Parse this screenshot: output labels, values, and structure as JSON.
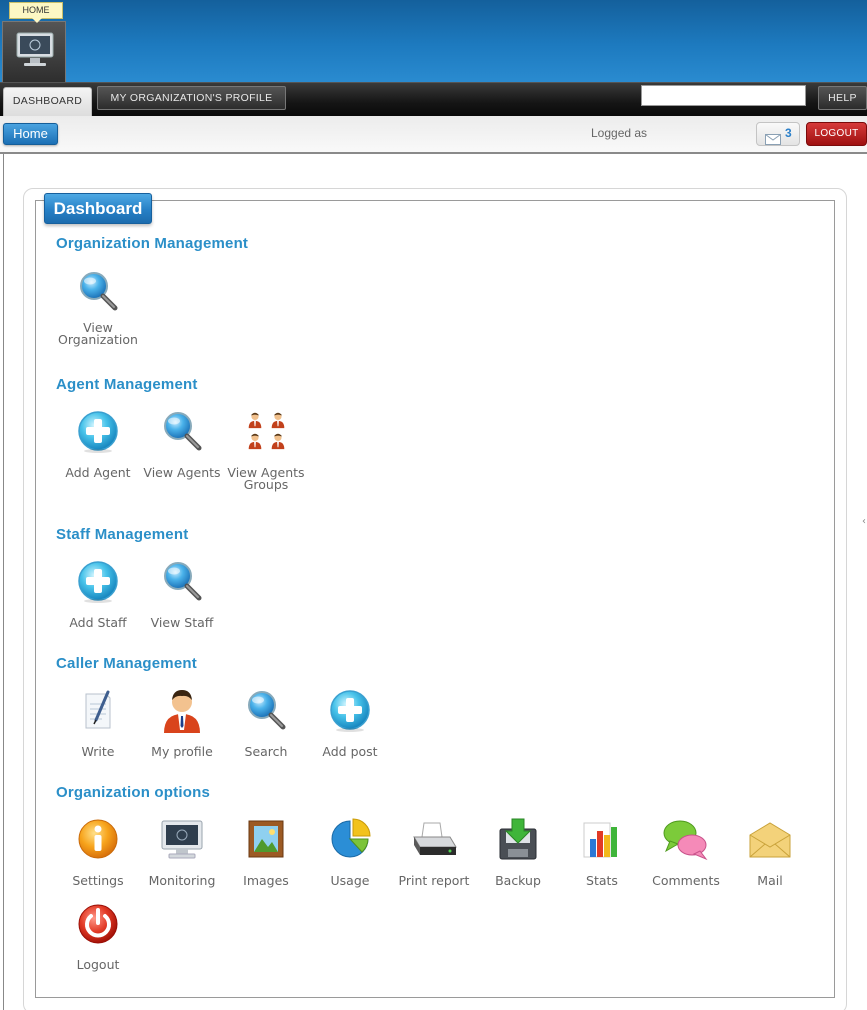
{
  "header": {
    "home_tooltip": "HOME",
    "home_icon": "monitor-icon"
  },
  "nav": {
    "tabs": [
      {
        "label": "DASHBOARD",
        "active": true
      },
      {
        "label": "MY ORGANIZATION'S PROFILE",
        "active": false
      }
    ],
    "search_value": "",
    "help_label": "HELP"
  },
  "subheader": {
    "home_label": "Home",
    "logged_as": "Logged as",
    "message_count": "3",
    "message_icon": "envelope-icon",
    "logout_label": "LOGOUT"
  },
  "dashboard": {
    "title": "Dashboard",
    "sections": [
      {
        "title": "Organization Management",
        "items": [
          {
            "label": "View Organization",
            "icon": "magnifier-icon"
          }
        ]
      },
      {
        "title": "Agent Management",
        "items": [
          {
            "label": "Add Agent",
            "icon": "add-plus-icon"
          },
          {
            "label": "View Agents",
            "icon": "magnifier-icon"
          },
          {
            "label": "View Agents Groups",
            "icon": "people-group-icon"
          }
        ]
      },
      {
        "title": "Staff Management",
        "items": [
          {
            "label": "Add Staff",
            "icon": "add-plus-icon"
          },
          {
            "label": "View Staff",
            "icon": "magnifier-icon"
          }
        ]
      },
      {
        "title": "Caller Management",
        "items": [
          {
            "label": "Write",
            "icon": "pen-paper-icon"
          },
          {
            "label": "My profile",
            "icon": "user-avatar-icon"
          },
          {
            "label": "Search",
            "icon": "magnifier-icon"
          },
          {
            "label": "Add post",
            "icon": "add-plus-icon"
          }
        ]
      },
      {
        "title": "Organization options",
        "items": [
          {
            "label": "Settings",
            "icon": "info-settings-icon"
          },
          {
            "label": "Monitoring",
            "icon": "monitor-icon"
          },
          {
            "label": "Images",
            "icon": "picture-frame-icon"
          },
          {
            "label": "Usage",
            "icon": "pie-chart-icon"
          },
          {
            "label": "Print report",
            "icon": "printer-icon"
          },
          {
            "label": "Backup",
            "icon": "backup-download-icon"
          },
          {
            "label": "Stats",
            "icon": "bar-chart-icon"
          },
          {
            "label": "Comments",
            "icon": "speech-bubbles-icon"
          },
          {
            "label": "Mail",
            "icon": "envelope-icon"
          },
          {
            "label": "Logout",
            "icon": "power-icon"
          }
        ]
      }
    ]
  },
  "colors": {
    "banner_blue": "#1d7abf",
    "section_title": "#2b8fc8",
    "logout_red": "#b51c1c"
  }
}
